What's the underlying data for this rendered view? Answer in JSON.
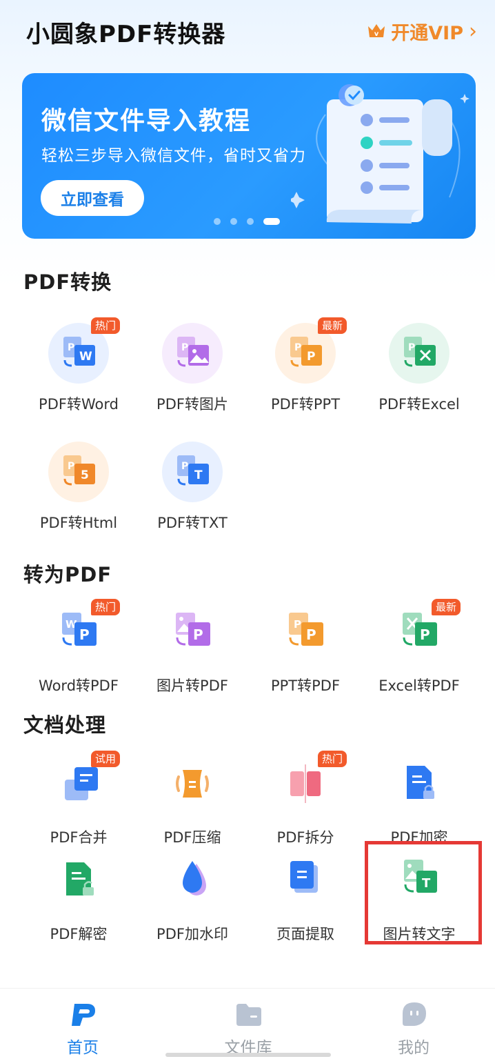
{
  "header": {
    "app_title": "小圆象PDF转换器",
    "vip_label": "开通VIP",
    "vip_color": "#f0892a"
  },
  "banner": {
    "title": "微信文件导入教程",
    "subtitle": "轻松三步导入微信文件，省时又省力",
    "button_label": "立即查看",
    "page_count": 4,
    "active_page": 4
  },
  "sections": [
    {
      "title": "PDF转换",
      "items": [
        {
          "label": "PDF转Word",
          "badge": "热门",
          "icon": "pdf-to-word-icon"
        },
        {
          "label": "PDF转图片",
          "badge": "",
          "icon": "pdf-to-image-icon"
        },
        {
          "label": "PDF转PPT",
          "badge": "最新",
          "icon": "pdf-to-ppt-icon"
        },
        {
          "label": "PDF转Excel",
          "badge": "",
          "icon": "pdf-to-excel-icon"
        },
        {
          "label": "PDF转Html",
          "badge": "",
          "icon": "pdf-to-html-icon"
        },
        {
          "label": "PDF转TXT",
          "badge": "",
          "icon": "pdf-to-txt-icon"
        }
      ]
    },
    {
      "title": "转为PDF",
      "items": [
        {
          "label": "Word转PDF",
          "badge": "热门",
          "icon": "word-to-pdf-icon"
        },
        {
          "label": "图片转PDF",
          "badge": "",
          "icon": "image-to-pdf-icon"
        },
        {
          "label": "PPT转PDF",
          "badge": "",
          "icon": "ppt-to-pdf-icon"
        },
        {
          "label": "Excel转PDF",
          "badge": "最新",
          "icon": "excel-to-pdf-icon"
        }
      ]
    },
    {
      "title": "文档处理",
      "items": [
        {
          "label": "PDF合并",
          "badge": "试用",
          "icon": "pdf-merge-icon"
        },
        {
          "label": "PDF压缩",
          "badge": "",
          "icon": "pdf-compress-icon"
        },
        {
          "label": "PDF拆分",
          "badge": "热门",
          "icon": "pdf-split-icon"
        },
        {
          "label": "PDF加密",
          "badge": "",
          "icon": "pdf-encrypt-icon"
        },
        {
          "label": "PDF解密",
          "badge": "",
          "icon": "pdf-decrypt-icon"
        },
        {
          "label": "PDF加水印",
          "badge": "",
          "icon": "pdf-watermark-icon"
        },
        {
          "label": "页面提取",
          "badge": "",
          "icon": "page-extract-icon"
        },
        {
          "label": "图片转文字",
          "badge": "",
          "icon": "image-to-text-icon"
        }
      ]
    }
  ],
  "tabbar": {
    "items": [
      {
        "label": "首页",
        "icon": "home-icon",
        "active": true
      },
      {
        "label": "文件库",
        "icon": "folder-icon",
        "active": false
      },
      {
        "label": "我的",
        "icon": "profile-icon",
        "active": false
      }
    ],
    "active_color": "#1a7fe8",
    "inactive_color": "#9aa0a6"
  },
  "colors": {
    "badge": "#f25a2b",
    "highlight_border": "#e53935",
    "banner": "#1e8cff"
  }
}
